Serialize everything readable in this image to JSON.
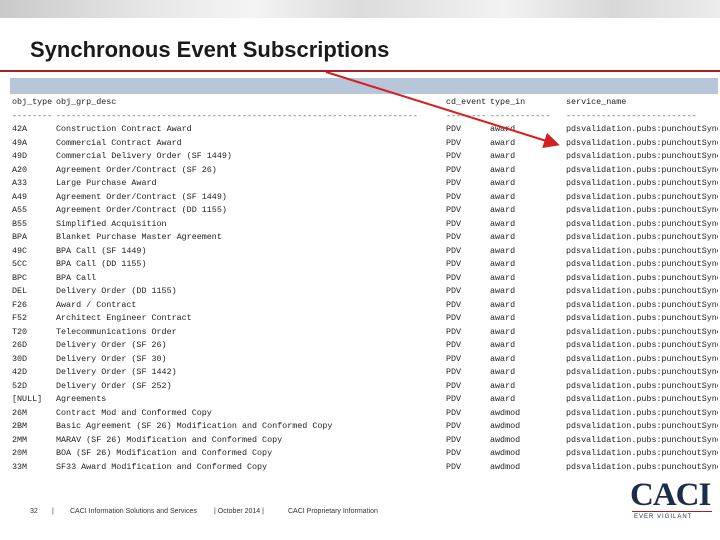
{
  "slide": {
    "title": "Synchronous Event Subscriptions"
  },
  "table": {
    "columns": [
      "obj_type",
      "obj_grp_desc",
      "cd_event",
      "type_in",
      "service_name"
    ],
    "separators": [
      "--------",
      "------------------------------------------------------------------------",
      "--------",
      "------------",
      "--------------------------"
    ],
    "rows": [
      [
        "42A",
        "Construction Contract Award",
        "PDV",
        "award",
        "pdsvalidation.pubs:punchoutSynch"
      ],
      [
        "49A",
        "Commercial Contract Award",
        "PDV",
        "award",
        "pdsvalidation.pubs:punchoutSynch"
      ],
      [
        "49D",
        "Commercial Delivery Order (SF 1449)",
        "PDV",
        "award",
        "pdsvalidation.pubs:punchoutSynch"
      ],
      [
        "A20",
        "Agreement Order/Contract (SF 26)",
        "PDV",
        "award",
        "pdsvalidation.pubs:punchoutSynch"
      ],
      [
        "A33",
        "Large Purchase Award",
        "PDV",
        "award",
        "pdsvalidation.pubs:punchoutSynch"
      ],
      [
        "A49",
        "Agreement Order/Contract (SF 1449)",
        "PDV",
        "award",
        "pdsvalidation.pubs:punchoutSynch"
      ],
      [
        "A55",
        "Agreement Order/Contract (DD 1155)",
        "PDV",
        "award",
        "pdsvalidation.pubs:punchoutSynch"
      ],
      [
        "B55",
        "Simplified Acquisition",
        "PDV",
        "award",
        "pdsvalidation.pubs:punchoutSynch"
      ],
      [
        "BPA",
        "Blanket Purchase Master Agreement",
        "PDV",
        "award",
        "pdsvalidation.pubs:punchoutSynch"
      ],
      [
        "49C",
        "BPA Call (SF 1449)",
        "PDV",
        "award",
        "pdsvalidation.pubs:punchoutSynch"
      ],
      [
        "5CC",
        "BPA Call (DD 1155)",
        "PDV",
        "award",
        "pdsvalidation.pubs:punchoutSynch"
      ],
      [
        "BPC",
        "BPA Call",
        "PDV",
        "award",
        "pdsvalidation.pubs:punchoutSynch"
      ],
      [
        "DEL",
        "Delivery Order (DD 1155)",
        "PDV",
        "award",
        "pdsvalidation.pubs:punchoutSynch"
      ],
      [
        "F26",
        "Award / Contract",
        "PDV",
        "award",
        "pdsvalidation.pubs:punchoutSynch"
      ],
      [
        "F52",
        "Architect Engineer Contract",
        "PDV",
        "award",
        "pdsvalidation.pubs:punchoutSynch"
      ],
      [
        "T20",
        "Telecommunications Order",
        "PDV",
        "award",
        "pdsvalidation.pubs:punchoutSynch"
      ],
      [
        "26D",
        "Delivery Order (SF 26)",
        "PDV",
        "award",
        "pdsvalidation.pubs:punchoutSynch"
      ],
      [
        "30D",
        "Delivery Order (SF 30)",
        "PDV",
        "award",
        "pdsvalidation.pubs:punchoutSynch"
      ],
      [
        "42D",
        "Delivery Order (SF 1442)",
        "PDV",
        "award",
        "pdsvalidation.pubs:punchoutSynch"
      ],
      [
        "52D",
        "Delivery Order (SF 252)",
        "PDV",
        "award",
        "pdsvalidation.pubs:punchoutSynch"
      ],
      [
        "[NULL]",
        "Agreements",
        "PDV",
        "award",
        "pdsvalidation.pubs:punchoutSynch"
      ],
      [
        "26M",
        "Contract Mod and Conformed Copy",
        "PDV",
        "awdmod",
        "pdsvalidation.pubs:punchoutSynch"
      ],
      [
        "2BM",
        "Basic Agreement (SF 26) Modification and Conformed Copy",
        "PDV",
        "awdmod",
        "pdsvalidation.pubs:punchoutSynch"
      ],
      [
        "2MM",
        "MARAV (SF 26) Modification and Conformed Copy",
        "PDV",
        "awdmod",
        "pdsvalidation.pubs:punchoutSynch"
      ],
      [
        "20M",
        "BOA (SF 26) Modification and Conformed Copy",
        "PDV",
        "awdmod",
        "pdsvalidation.pubs:punchoutSynch"
      ],
      [
        "33M",
        "SF33 Award Modification and Conformed Copy",
        "PDV",
        "awdmod",
        "pdsvalidation.pubs:punchoutSynch"
      ]
    ]
  },
  "footer": {
    "page_number": "32",
    "divider1": "|",
    "company": "CACI Information Solutions and Services",
    "date": "| October 2014 |",
    "notice": "CACI Proprietary Information"
  },
  "logo": {
    "text": "CACI",
    "tagline": "EVER VIGILANT"
  },
  "colors": {
    "accent": "#a51f24",
    "header_band": "#b7c6d8",
    "arrow": "#d42020"
  }
}
